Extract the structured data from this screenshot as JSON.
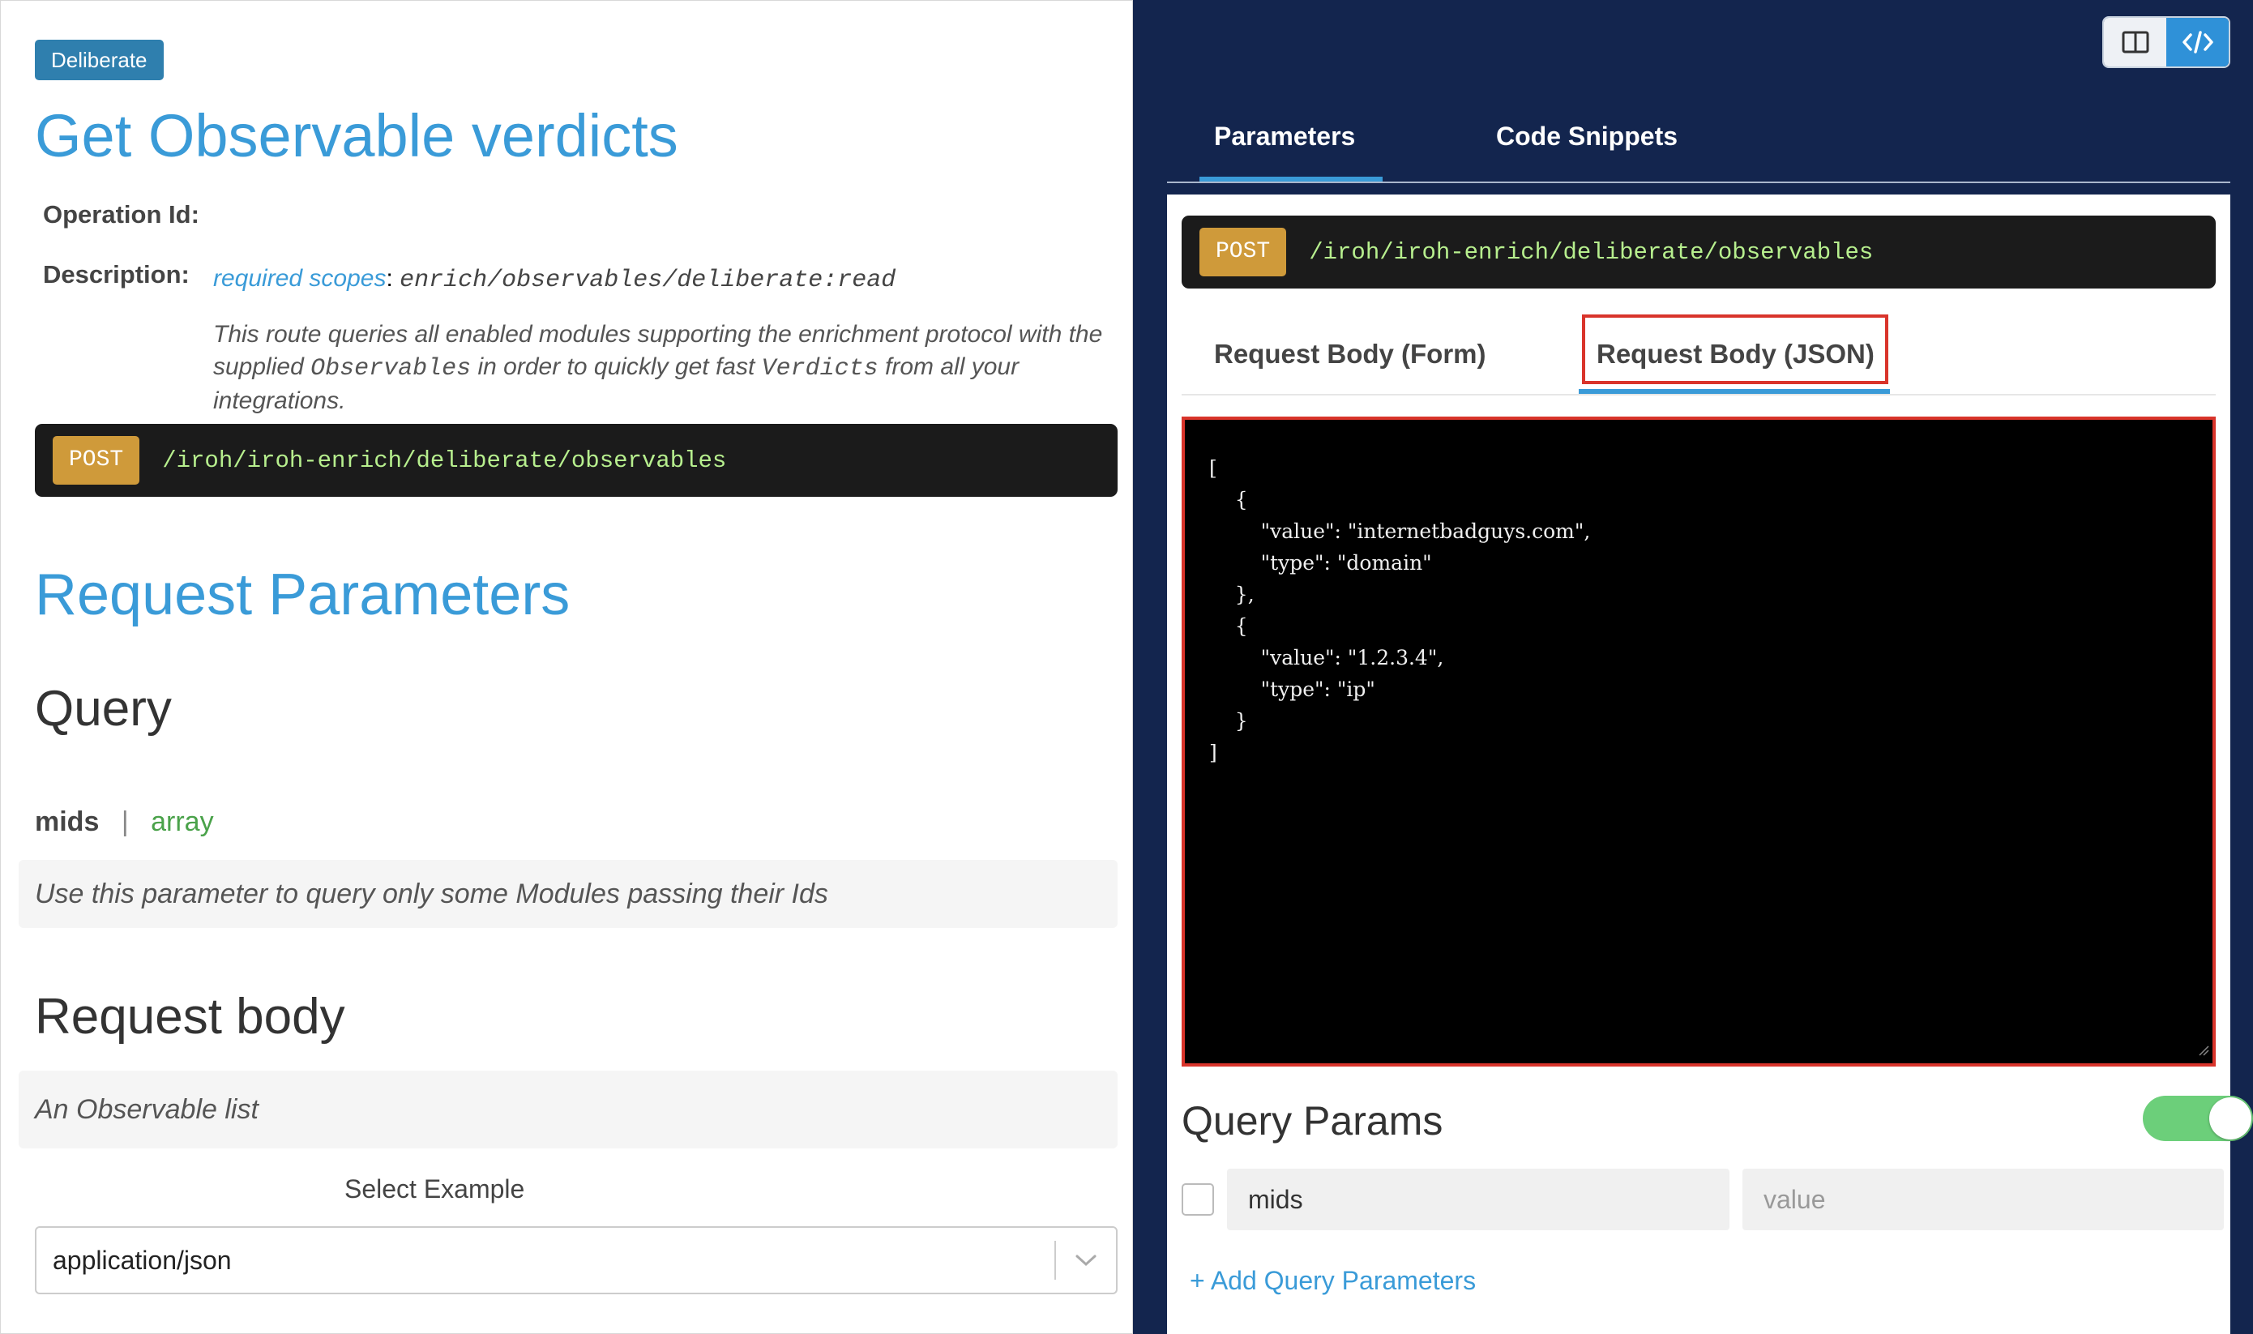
{
  "left": {
    "tag": "Deliberate",
    "title": "Get Observable verdicts",
    "operation_id_label": "Operation Id:",
    "description_label": "Description:",
    "scopes_link": "required scopes",
    "scopes_colon": ":",
    "scopes_value": "enrich/observables/deliberate:read",
    "description_text": {
      "part1": "This route queries all enabled modules supporting the enrichment protocol with the supplied ",
      "code1": "Observables",
      "part2": " in order to quickly get fast ",
      "code2": "Verdicts",
      "part3": " from all your integrations."
    },
    "endpoint": {
      "method": "POST",
      "path": "/iroh/iroh-enrich/deliberate/observables"
    },
    "request_parameters_title": "Request Parameters",
    "query_title": "Query",
    "param": {
      "name": "mids",
      "separator": "|",
      "type": "array",
      "description": "Use this parameter to query only some Modules passing their Ids"
    },
    "request_body_title": "Request body",
    "request_body_description": "An Observable list",
    "select_example_label": "Select Example",
    "content_type": "application/json"
  },
  "right": {
    "tabs": [
      "Parameters",
      "Code Snippets"
    ],
    "active_tab": "Parameters",
    "endpoint": {
      "method": "POST",
      "path": "/iroh/iroh-enrich/deliberate/observables"
    },
    "body_tabs": [
      "Request Body (Form)",
      "Request Body (JSON)"
    ],
    "active_body_tab": "Request Body (JSON)",
    "json_body": "[\n    {\n        \"value\": \"internetbadguys.com\",\n        \"type\": \"domain\"\n    },\n    {\n        \"value\": \"1.2.3.4\",\n        \"type\": \"ip\"\n    }\n]",
    "query_params_title": "Query Params",
    "query_params_enabled": true,
    "query_param_row": {
      "name": "mids",
      "value_placeholder": "value",
      "checked": false
    },
    "add_query_label": "+ Add Query Parameters"
  },
  "colors": {
    "accent_blue": "#3a9bd8",
    "tag_blue": "#2f7fae",
    "post_orange": "#cf9a3a",
    "path_green": "#b7ef8e",
    "right_bg_navy": "#13254e",
    "highlight_red": "#d9342b",
    "toggle_green": "#6ccf7a"
  },
  "icons": {
    "view_split": "split-view-icon",
    "view_code": "code-view-icon",
    "select_chevron": "chevron-down-icon"
  }
}
